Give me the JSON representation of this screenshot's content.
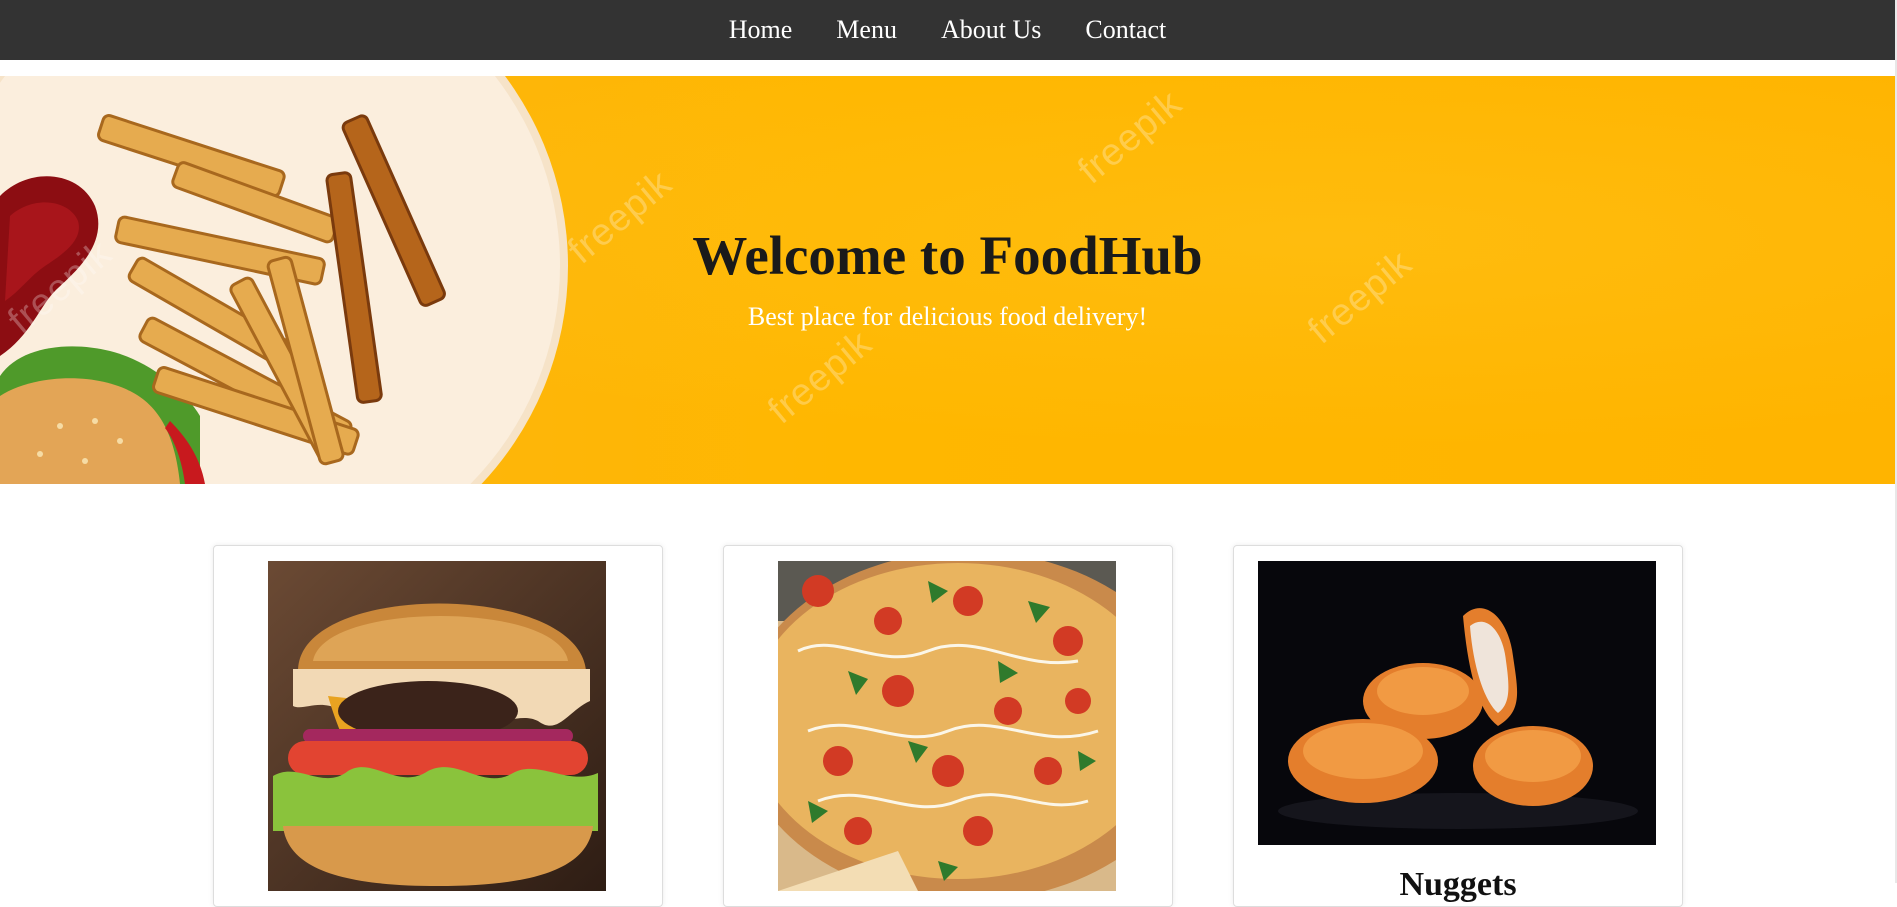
{
  "nav": {
    "links": [
      {
        "label": "Home"
      },
      {
        "label": "Menu"
      },
      {
        "label": "About Us"
      },
      {
        "label": "Contact"
      }
    ]
  },
  "hero": {
    "title": "Welcome to FoodHub",
    "subtitle": "Best place for delicious food delivery!",
    "watermark": "freepik",
    "colors": {
      "background": "#ffb400",
      "title": "#1a1a1a",
      "subtitle": "#ffffff"
    }
  },
  "cards": [
    {
      "image": "burger-image",
      "title": ""
    },
    {
      "image": "pizza-image",
      "title": ""
    },
    {
      "image": "nuggets-image",
      "title": "Nuggets"
    }
  ],
  "colors": {
    "navbar": "#333333",
    "nav_text": "#ffffff",
    "page": "#ffffff"
  }
}
